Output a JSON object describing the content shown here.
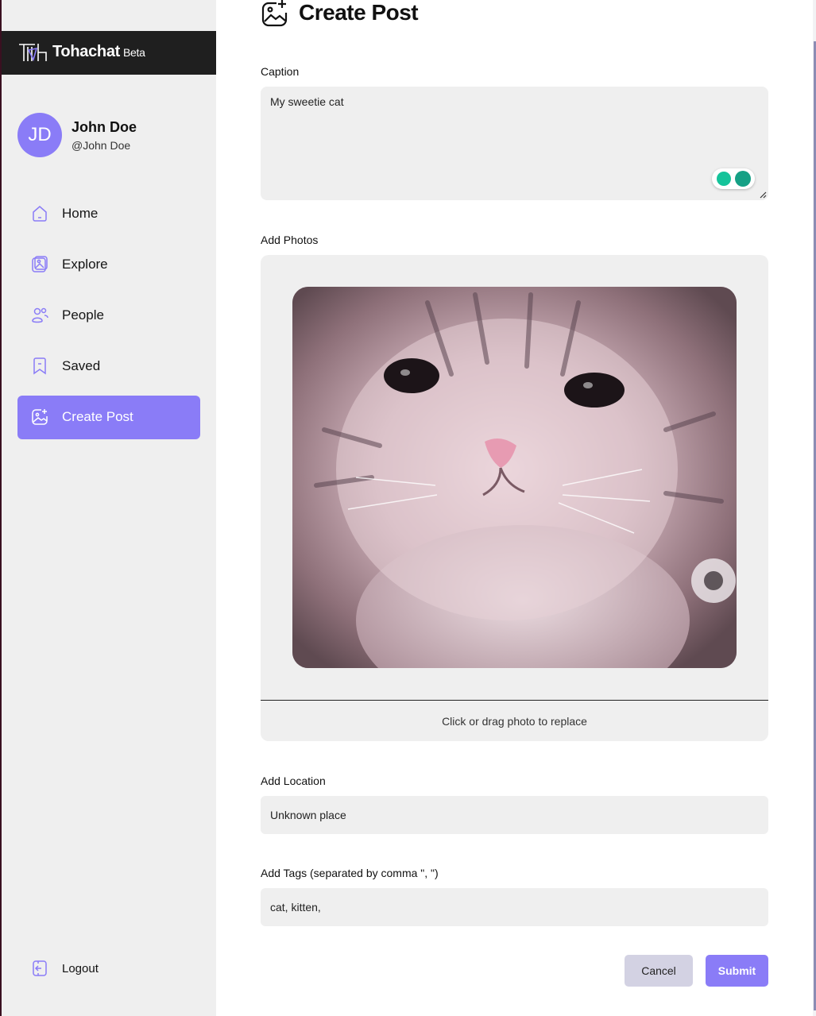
{
  "brand": {
    "name": "Tohachat",
    "tag": "Beta"
  },
  "profile": {
    "initials": "JD",
    "name": "John Doe",
    "handle": "@John Doe"
  },
  "nav": {
    "items": [
      {
        "label": "Home",
        "icon": "home-icon"
      },
      {
        "label": "Explore",
        "icon": "gallery-icon"
      },
      {
        "label": "People",
        "icon": "people-icon"
      },
      {
        "label": "Saved",
        "icon": "bookmark-icon"
      },
      {
        "label": "Create Post",
        "icon": "image-plus-icon",
        "active": true
      }
    ],
    "logout_label": "Logout"
  },
  "page": {
    "title": "Create Post"
  },
  "form": {
    "caption_label": "Caption",
    "caption_value": "My sweetie cat",
    "photos_label": "Add Photos",
    "photo_hint": "Click or drag photo to replace",
    "location_label": "Add Location",
    "location_value": "Unknown place",
    "tags_label": "Add Tags (separated by comma \", \")",
    "tags_value": "cat, kitten,",
    "cancel_label": "Cancel",
    "submit_label": "Submit"
  },
  "colors": {
    "accent": "#8a7cf7",
    "sidebar_bg": "#efefef",
    "brand_bar_bg": "#1f1f1f",
    "field_bg": "#efefef",
    "cancel_bg": "#d3d2e3"
  }
}
